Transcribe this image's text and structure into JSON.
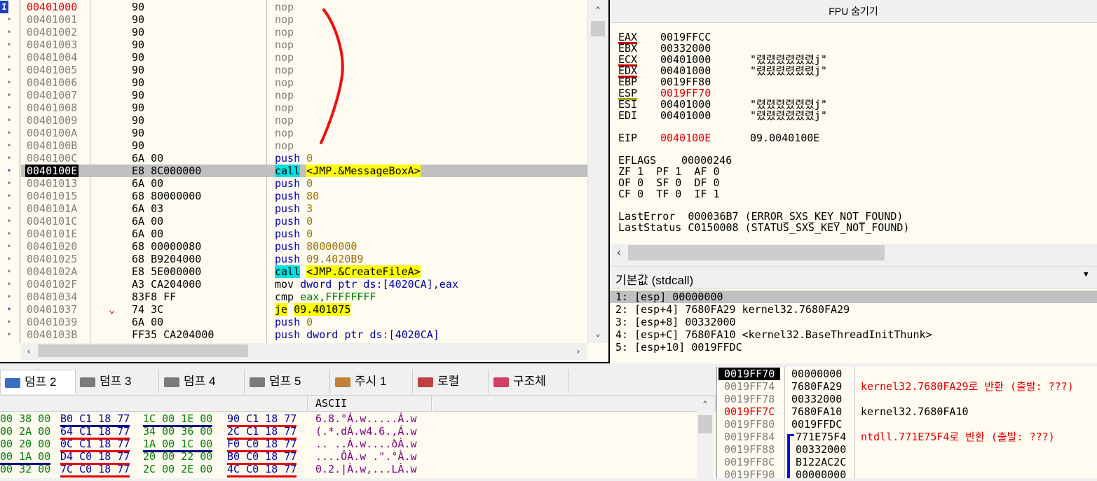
{
  "disasm": {
    "rows": [
      {
        "addr": "00401000",
        "bytes": "90",
        "mnemonic": "nop",
        "addr_style": "red"
      },
      {
        "addr": "00401001",
        "bytes": "90",
        "mnemonic": "nop"
      },
      {
        "addr": "00401002",
        "bytes": "90",
        "mnemonic": "nop"
      },
      {
        "addr": "00401003",
        "bytes": "90",
        "mnemonic": "nop"
      },
      {
        "addr": "00401004",
        "bytes": "90",
        "mnemonic": "nop"
      },
      {
        "addr": "00401005",
        "bytes": "90",
        "mnemonic": "nop"
      },
      {
        "addr": "00401006",
        "bytes": "90",
        "mnemonic": "nop"
      },
      {
        "addr": "00401007",
        "bytes": "90",
        "mnemonic": "nop"
      },
      {
        "addr": "00401008",
        "bytes": "90",
        "mnemonic": "nop"
      },
      {
        "addr": "00401009",
        "bytes": "90",
        "mnemonic": "nop"
      },
      {
        "addr": "0040100A",
        "bytes": "90",
        "mnemonic": "nop"
      },
      {
        "addr": "0040100B",
        "bytes": "90",
        "mnemonic": "nop"
      },
      {
        "addr": "0040100C",
        "bytes": "6A 00",
        "mnemonic": "push",
        "operand": "0"
      },
      {
        "addr": "0040100E",
        "bytes": "E8 8C000000",
        "mnemonic": "call",
        "operand": "<JMP.&MessageBoxA>",
        "current": true
      },
      {
        "addr": "00401013",
        "bytes": "6A 00",
        "mnemonic": "push",
        "operand": "0"
      },
      {
        "addr": "00401015",
        "bytes": "68 80000000",
        "mnemonic": "push",
        "operand": "80"
      },
      {
        "addr": "0040101A",
        "bytes": "6A 03",
        "mnemonic": "push",
        "operand": "3"
      },
      {
        "addr": "0040101C",
        "bytes": "6A 00",
        "mnemonic": "push",
        "operand": "0"
      },
      {
        "addr": "0040101E",
        "bytes": "6A 00",
        "mnemonic": "push",
        "operand": "0"
      },
      {
        "addr": "00401020",
        "bytes": "68 00000080",
        "mnemonic": "push",
        "operand": "80000000"
      },
      {
        "addr": "00401025",
        "bytes": "68 B9204000",
        "mnemonic": "push",
        "operand": "09.4020B9"
      },
      {
        "addr": "0040102A",
        "bytes": "E8 5E000000",
        "mnemonic": "call",
        "operand": "<JMP.&CreateFileA>"
      },
      {
        "addr": "0040102F",
        "bytes": "A3 CA204000",
        "mnemonic": "mov",
        "operand": "dword ptr ds:[4020CA],eax"
      },
      {
        "addr": "00401034",
        "bytes": "83F8 FF",
        "mnemonic": "cmp",
        "operand": "eax,FFFFFFFF"
      },
      {
        "addr": "00401037",
        "bytes": "74 3C",
        "mnemonic": "je",
        "operand": "09.401075"
      },
      {
        "addr": "00401039",
        "bytes": "6A 00",
        "mnemonic": "push",
        "operand": "0"
      },
      {
        "addr": "0040103B",
        "bytes": "FF35 CA204000",
        "mnemonic": "push",
        "operand": "dword ptr ds:[4020CA]"
      }
    ]
  },
  "registers": {
    "header": "FPU 숨기기",
    "gp": [
      {
        "name": "EAX",
        "value": "0019FFCC",
        "comment": "",
        "mark": "red"
      },
      {
        "name": "EBX",
        "value": "00332000",
        "comment": ""
      },
      {
        "name": "ECX",
        "value": "00401000",
        "comment": "\"렸렸렸렸렸렸j\"",
        "mark": "red"
      },
      {
        "name": "EDX",
        "value": "00401000",
        "comment": "\"렸렸렸렸렸렸j\"",
        "mark": "red"
      },
      {
        "name": "EBP",
        "value": "0019FF80",
        "comment": ""
      },
      {
        "name": "ESP",
        "value": "0019FF70",
        "comment": "",
        "mark": "olive",
        "value_red": true
      },
      {
        "name": "ESI",
        "value": "00401000",
        "comment": "\"렸렸렸렸렸렸j\""
      },
      {
        "name": "EDI",
        "value": "00401000",
        "comment": "\"렸렸렸렸렸렸j\""
      }
    ],
    "eip": {
      "name": "EIP",
      "value": "0040100E",
      "comment": "09.0040100E"
    },
    "eflags": {
      "name": "EFLAGS",
      "value": "00000246"
    },
    "flags_rows": [
      "ZF 1  PF 1  AF 0",
      "OF 0  SF 0  DF 0",
      "CF 0  TF 0  IF 1"
    ],
    "last_error": "LastError  000036B7 (ERROR_SXS_KEY_NOT_FOUND)",
    "last_status": "LastStatus C0150008 (STATUS_SXS_KEY_NOT_FOUND)"
  },
  "callconv": {
    "selected": "기본값 (stdcall)"
  },
  "stack_args": [
    "1: [esp] 00000000",
    "2: [esp+4] 7680FA29 kernel32.7680FA29",
    "3: [esp+8] 00332000",
    "4: [esp+C] 7680FA10 <kernel32.BaseThreadInitThunk>",
    "5: [esp+10] 0019FFDC"
  ],
  "tabs": [
    {
      "label": "덤프 2",
      "active": true,
      "icon_color": "#3a6fc0"
    },
    {
      "label": "덤프 3",
      "icon_color": "#7a7a7a"
    },
    {
      "label": "덤프 4",
      "icon_color": "#7a7a7a"
    },
    {
      "label": "덤프 5",
      "icon_color": "#7a7a7a"
    },
    {
      "label": "주시 1",
      "icon_color": "#c0803a"
    },
    {
      "label": "로컬",
      "icon_color": "#c04040"
    },
    {
      "label": "구조체",
      "icon_color": "#d04060"
    }
  ],
  "dump": {
    "ascii_header": "ASCII",
    "rows": [
      {
        "g0": "00 38 00",
        "g1": "B0 C1 18 77",
        "g2": "1C 00 1E 00",
        "g3": "90 C1 18 77",
        "ascii": "6.8.°Á.w.....Á.w",
        "u1": "navy",
        "u2": "navy",
        "u3": "red"
      },
      {
        "g0": "00 2A 00",
        "g1": "64 C1 18 77",
        "g2": "34 00 36 00",
        "g3": "2C C1 18 77",
        "ascii": "(.*.dÁ.w4.6.,Á.w",
        "u1": "red",
        "u3": "red"
      },
      {
        "g0": "00 20 00",
        "g1": "0C C1 18 77",
        "g2": "1A 00 1C 00",
        "g3": "F0 C0 18 77",
        "ascii": ".. ..Á.w....ðÀ.w",
        "u1": "red",
        "u2": "navy",
        "u3": "red"
      },
      {
        "g0": "00 1A 00",
        "g1": "D4 C0 18 77",
        "g2": "20 00 22 00",
        "g3": "B0 C0 18 77",
        "ascii": "....ÔÀ.w .\".°À.w",
        "u0": "navy",
        "u1": "red",
        "u3": "red"
      },
      {
        "g0": "00 32 00",
        "g1": "7C C0 18 77",
        "g2": "2C 00 2E 00",
        "g3": "4C C0 18 77",
        "ascii": "0.2.|À.w,...LÀ.w",
        "u1": "red",
        "u3": "red"
      }
    ]
  },
  "stack": [
    {
      "addr": "0019FF70",
      "value": "00000000",
      "comment": "",
      "current": true
    },
    {
      "addr": "0019FF74",
      "value": "7680FA29",
      "comment": "kernel32.7680FA29로 반환 (출발: ???)",
      "comment_red": true
    },
    {
      "addr": "0019FF78",
      "value": "00332000",
      "comment": ""
    },
    {
      "addr": "0019FF7C",
      "value": "7680FA10",
      "comment": "kernel32.7680FA10",
      "addr_red": true
    },
    {
      "addr": "0019FF80",
      "value": "0019FFDC",
      "comment": ""
    },
    {
      "addr": "0019FF84",
      "value": "771E75F4",
      "comment": "ntdll.771E75F4로 반환 (출발: ???)",
      "comment_red": true
    },
    {
      "addr": "0019FF88",
      "value": "00332000",
      "comment": ""
    },
    {
      "addr": "0019FF8C",
      "value": "B122AC2C",
      "comment": ""
    },
    {
      "addr": "0019FF90",
      "value": "00000000",
      "comment": ""
    }
  ]
}
